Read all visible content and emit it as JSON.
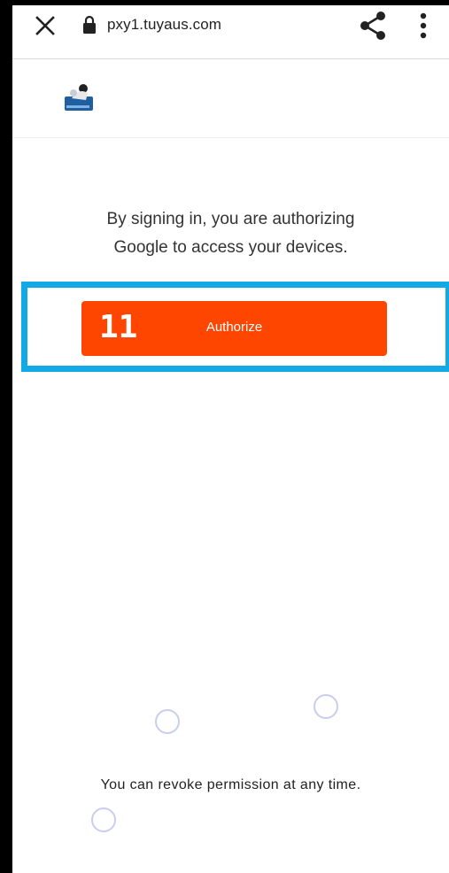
{
  "browser": {
    "url": "pxy1.tuyaus.com",
    "icons": [
      "close-icon",
      "lock-icon",
      "share-icon",
      "more-vertical-icon"
    ]
  },
  "site": {
    "logo_icon": "site-logo"
  },
  "main": {
    "auth_line1": "By signing in, you are authorizing",
    "auth_line2": "Google to access your devices.",
    "authorize_label": "Authorize",
    "annotation_number": "11",
    "revoke_text": "You can revoke permission at any time."
  },
  "colors": {
    "button": "#ff4600",
    "highlight": "#13a8e6",
    "ring": "#c9cdef"
  }
}
